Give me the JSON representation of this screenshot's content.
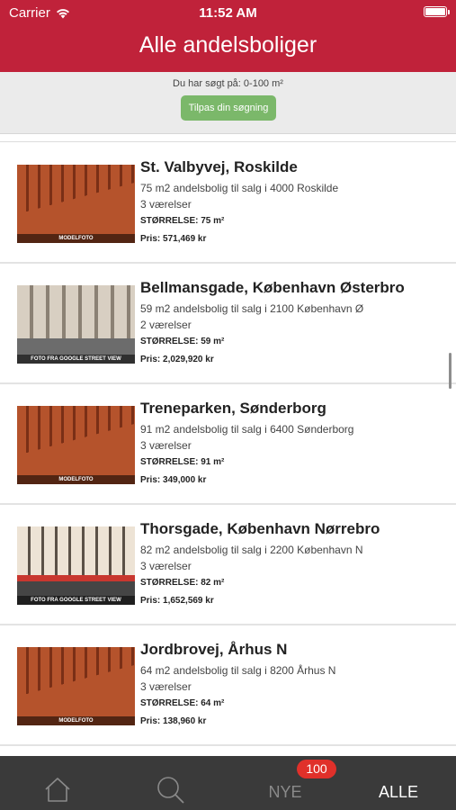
{
  "status_bar": {
    "carrier": "Carrier",
    "time": "11:52 AM"
  },
  "header": {
    "title": "Alle andelsboliger"
  },
  "search": {
    "info": "Du har søgt på: 0-100 m²",
    "adjust_label": "Tilpas din søgning"
  },
  "listings": [
    {
      "title": "St. Valbyvej, Roskilde",
      "description": "75 m2 andelsbolig til salg i 4000 Roskilde",
      "rooms": "3 værelser",
      "size": "STØRRELSE: 75 m²",
      "price": "Pris: 571,469 kr",
      "image_caption": "MODELFOTO"
    },
    {
      "title": "Bellmansgade, København Østerbro",
      "description": "59 m2 andelsbolig til salg i 2100 København Ø",
      "rooms": "2 værelser",
      "size": "STØRRELSE: 59 m²",
      "price": "Pris: 2,029,920 kr",
      "image_caption": "FOTO FRA GOOGLE STREET VIEW"
    },
    {
      "title": "Treneparken, Sønderborg",
      "description": "91 m2 andelsbolig til salg i 6400 Sønderborg",
      "rooms": "3 værelser",
      "size": "STØRRELSE: 91 m²",
      "price": "Pris: 349,000 kr",
      "image_caption": "MODELFOTO"
    },
    {
      "title": "Thorsgade, København Nørrebro",
      "description": "82 m2 andelsbolig til salg i 2200 København N",
      "rooms": "3 værelser",
      "size": "STØRRELSE: 82 m²",
      "price": "Pris: 1,652,569 kr",
      "image_caption": "FOTO FRA GOOGLE STREET VIEW"
    },
    {
      "title": "Jordbrovej, Århus N",
      "description": "64 m2 andelsbolig til salg i 8200 Århus N",
      "rooms": "3 værelser",
      "size": "STØRRELSE: 64 m²",
      "price": "Pris: 138,960 kr",
      "image_caption": "MODELFOTO"
    }
  ],
  "tabbar": {
    "home_icon": "home-icon",
    "search_icon": "search-icon",
    "new_label": "NYE",
    "new_badge": "100",
    "all_label": "ALLE"
  },
  "colors": {
    "header": "#c0223a",
    "button": "#7bb86a",
    "tabbar": "#3a3a3a",
    "badge": "#e0302a"
  }
}
